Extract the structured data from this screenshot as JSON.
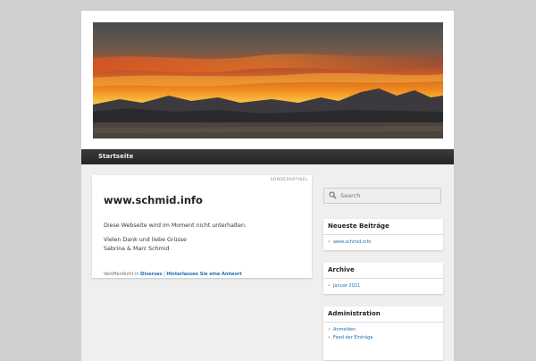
{
  "nav": {
    "home": "Startseite"
  },
  "article": {
    "featured_label": "SONDERARTIKEL",
    "title": "www.schmid.info",
    "paragraph1": "Diese Webseite wird im Moment nicht unterhalten.",
    "paragraph2_line1": "Vielen Dank und liebe Grüsse",
    "paragraph2_line2": "Sabrina & Marc Schmid",
    "meta_prefix": "Veröffentlicht in",
    "meta_category": "Diverses",
    "meta_separator": "|",
    "meta_reply": "Hinterlassen Sie eine Antwort"
  },
  "sidebar": {
    "search_placeholder": "Search",
    "recent": {
      "title": "Neueste Beiträge",
      "items": [
        "www.schmid.info"
      ]
    },
    "archive": {
      "title": "Archive",
      "items": [
        "Januar 2021"
      ]
    },
    "admin": {
      "title": "Administration",
      "items": [
        "Anmelden",
        "Feed der Einträge"
      ]
    }
  },
  "colors": {
    "link": "#1b6fb5",
    "nav_bg": "#2f2f2f",
    "page_bg": "#cfcfcf"
  },
  "icons": {
    "search": "search-icon"
  }
}
